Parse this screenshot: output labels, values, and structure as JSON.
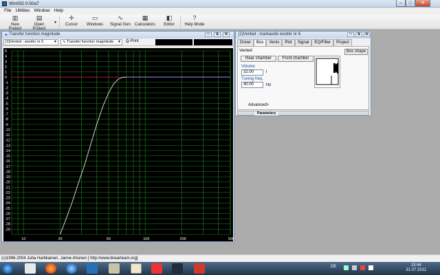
{
  "window": {
    "title": "WinISD 0.50a7"
  },
  "menu": [
    "File",
    "Utilities",
    "Window",
    "Help"
  ],
  "toolbar": {
    "new_project": "New Project",
    "open_project": "Open Project",
    "cursor": "Cursor",
    "windows": "Windows",
    "signal_gen": "Signal Gen",
    "calculators": "Calculators",
    "editor": "Editor",
    "help_mode": "Help Mode"
  },
  "tf_window": {
    "title": "Transfer function magnitude",
    "project_combo": "[1]Vented : woofer nr 6",
    "graph_combo": "Transfer function magnitude",
    "print": "Print"
  },
  "box_window": {
    "title": "[1]Vented : markaudio woofer nr 6",
    "tabs": [
      "Driver",
      "Box",
      "Vents",
      "Plot",
      "Signal",
      "EQ/Filter",
      "Project"
    ],
    "active_tab": "Box",
    "box_type": "Vented",
    "box_shape_button": "Box shape",
    "rear_chamber": "Rear chamber",
    "front_chamber": "Front chamber",
    "volume_label": "Volume",
    "volume_value": "32.00",
    "volume_unit": "l",
    "tuning_label": "Tuning freq.",
    "tuning_value": "40.00",
    "tuning_unit": "Hz",
    "advanced": "Advanced>",
    "bottom_tab": "Parameters"
  },
  "statusbar": {
    "text": "(c)1996-2004 Juha Hartikainen, Janne Ahonen [ http://www.linearteam.org]"
  },
  "taskbar": {
    "language": "DE",
    "time": "13:44",
    "date": "31.07.2011"
  },
  "colors": {
    "plot_bg": "#000000",
    "grid": "#1f8a1f",
    "curve": "#e8e8e8",
    "zero_line": "#c0143c",
    "ref_line": "#4a6cff"
  },
  "chart_data": {
    "type": "line",
    "xscale": "log",
    "xlim": [
      8,
      500
    ],
    "ylim": [
      -30,
      5
    ],
    "x_ticks": [
      10,
      20,
      50,
      100,
      200,
      500
    ],
    "y_ticks": [
      5,
      4,
      3,
      2,
      1,
      0,
      -1,
      -2,
      -3,
      -4,
      -5,
      -6,
      -7,
      -8,
      -9,
      -10,
      -11,
      -12,
      -13,
      -14,
      -15,
      -16,
      -17,
      -18,
      -19,
      -20,
      -21,
      -22,
      -23,
      -24,
      -25,
      -26,
      -27,
      -28,
      -29
    ],
    "grid": true,
    "series": [
      {
        "x": [
          20,
          22,
          25,
          28,
          32,
          36,
          40,
          45,
          50,
          55,
          60,
          65,
          70,
          80,
          100,
          150,
          200,
          300,
          500
        ],
        "y": [
          -30,
          -27.5,
          -24,
          -20.5,
          -16.5,
          -12.5,
          -9,
          -5.5,
          -3,
          -1.3,
          -0.4,
          -0.05,
          0,
          0,
          0,
          0,
          0,
          0,
          0
        ]
      }
    ]
  }
}
